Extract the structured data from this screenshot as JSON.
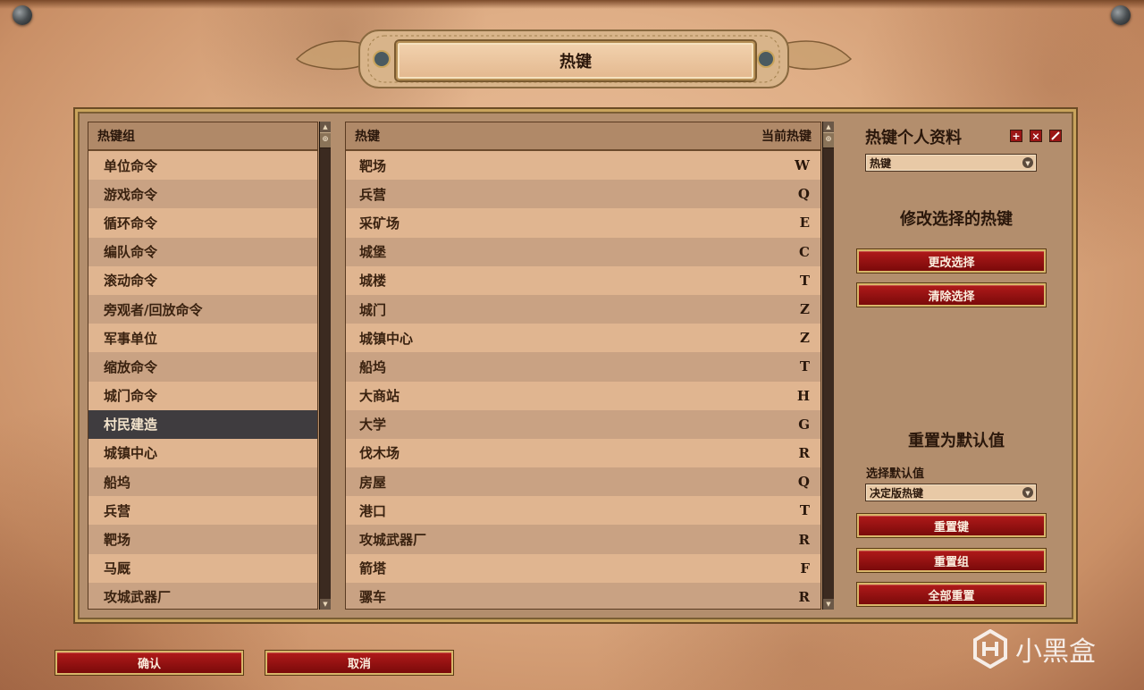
{
  "title": "热键",
  "groups_panel": {
    "header": "热键组",
    "items": [
      {
        "label": "单位命令"
      },
      {
        "label": "游戏命令"
      },
      {
        "label": "循环命令"
      },
      {
        "label": "编队命令"
      },
      {
        "label": "滚动命令"
      },
      {
        "label": "旁观者/回放命令"
      },
      {
        "label": "军事单位"
      },
      {
        "label": "缩放命令"
      },
      {
        "label": "城门命令"
      },
      {
        "label": "村民建造",
        "selected": true
      },
      {
        "label": "城镇中心"
      },
      {
        "label": "船坞"
      },
      {
        "label": "兵营"
      },
      {
        "label": "靶场"
      },
      {
        "label": "马厩"
      },
      {
        "label": "攻城武器厂"
      }
    ]
  },
  "hotkeys_panel": {
    "header_name": "热键",
    "header_current": "当前热键",
    "items": [
      {
        "label": "靶场",
        "key": "W"
      },
      {
        "label": "兵营",
        "key": "Q"
      },
      {
        "label": "采矿场",
        "key": "E"
      },
      {
        "label": "城堡",
        "key": "C"
      },
      {
        "label": "城楼",
        "key": "T"
      },
      {
        "label": "城门",
        "key": "Z"
      },
      {
        "label": "城镇中心",
        "key": "Z"
      },
      {
        "label": "船坞",
        "key": "T"
      },
      {
        "label": "大商站",
        "key": "H"
      },
      {
        "label": "大学",
        "key": "G"
      },
      {
        "label": "伐木场",
        "key": "R"
      },
      {
        "label": "房屋",
        "key": "Q"
      },
      {
        "label": "港口",
        "key": "T"
      },
      {
        "label": "攻城武器厂",
        "key": "R"
      },
      {
        "label": "箭塔",
        "key": "F"
      },
      {
        "label": "骡车",
        "key": "R"
      }
    ]
  },
  "side": {
    "profile_title": "热键个人资料",
    "profile_select_value": "热键",
    "modify_title": "修改选择的热键",
    "change_selection": "更改选择",
    "clear_selection": "清除选择",
    "reset_title": "重置为默认值",
    "select_default_label": "选择默认值",
    "default_select_value": "决定版热键",
    "reset_key": "重置键",
    "reset_group": "重置组",
    "reset_all": "全部重置"
  },
  "footer": {
    "confirm": "确认",
    "cancel": "取消"
  },
  "watermark": "小黑盒",
  "colors": {
    "button_red": "#9b1212",
    "selected_row": "#3f3c3f",
    "parchment": "#e3b893"
  },
  "icons": {
    "add_profile": "plus-icon",
    "delete_profile": "close-icon",
    "rename_profile": "pencil-icon",
    "dropdown": "chevron-down-icon",
    "scroll_up": "arrow-up-icon",
    "scroll_down": "arrow-down-icon"
  }
}
